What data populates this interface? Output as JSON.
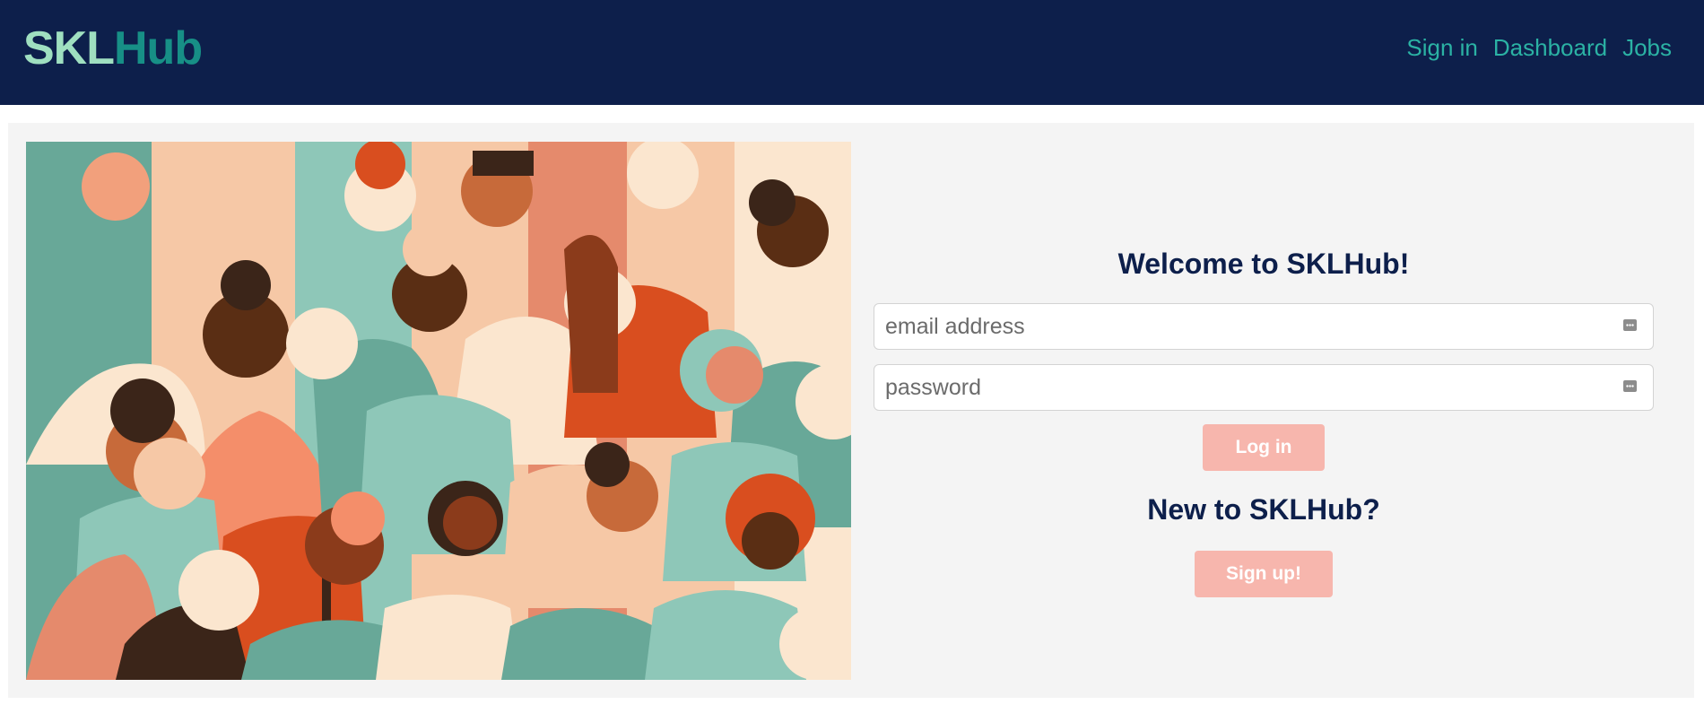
{
  "brand": {
    "part1": "SKL",
    "part2": "Hub"
  },
  "nav": {
    "signin": "Sign in",
    "dashboard": "Dashboard",
    "jobs": "Jobs"
  },
  "login": {
    "welcome": "Welcome to SKLHub!",
    "email_placeholder": "email address",
    "password_placeholder": "password",
    "login_button": "Log in",
    "new_title": "New to SKLHub?",
    "signup_button": "Sign up!"
  },
  "colors": {
    "navbar": "#0d1f4b",
    "brand_light": "#9fdfc0",
    "brand_teal": "#178f86",
    "nav_link": "#2bb2a4",
    "button": "#f7b6ad",
    "panel": "#f4f4f4"
  },
  "icons": {
    "field_icon": "password-manager-key-icon"
  }
}
